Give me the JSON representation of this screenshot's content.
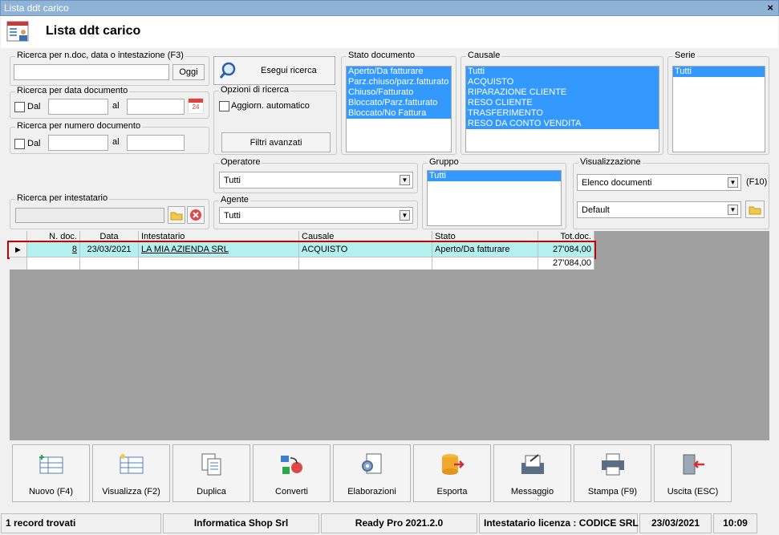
{
  "window": {
    "title": "Lista ddt carico",
    "close_glyph": "×"
  },
  "header": {
    "title": "Lista ddt carico",
    "icon": "document-list-icon"
  },
  "search_ndoc": {
    "label": "Ricerca per n.doc, data o intestazione (F3)",
    "value": "",
    "button": "Oggi"
  },
  "search_button": {
    "label": "Esegui ricerca",
    "icon": "search-icon"
  },
  "search_date": {
    "label": "Ricerca per data documento",
    "from_label": "Dal",
    "to_label": "al",
    "calendar_text": "24"
  },
  "search_number": {
    "label": "Ricerca per numero documento",
    "from_label": "Dal",
    "to_label": "al"
  },
  "options": {
    "label": "Opzioni di ricerca",
    "auto_update": "Aggiorn. automatico",
    "advanced_button": "Filtri avanzati"
  },
  "stato": {
    "label": "Stato documento",
    "items": [
      "Aperto/Da fatturare",
      "Parz.chiuso/parz.fatturato",
      "Chiuso/Fatturato",
      "Bloccato/Parz.fatturato",
      "Bloccato/No Fattura"
    ]
  },
  "causale": {
    "label": "Causale",
    "items": [
      "Tutti",
      "ACQUISTO",
      "RIPARAZIONE CLIENTE",
      "RESO CLIENTE",
      "TRASFERIMENTO",
      "RESO DA CONTO VENDITA"
    ]
  },
  "serie": {
    "label": "Serie",
    "items": [
      "Tutti"
    ]
  },
  "operatore": {
    "label": "Operatore",
    "value": "Tutti"
  },
  "agente": {
    "label": "Agente",
    "value": "Tutti"
  },
  "gruppo": {
    "label": "Gruppo",
    "items": [
      "Tutti"
    ]
  },
  "visualizzazione": {
    "label": "Visualizzazione",
    "value": "Elenco documenti",
    "shortcut": "(F10)",
    "layout": "Default"
  },
  "intestatario": {
    "label": "Ricerca per intestatario",
    "value": ""
  },
  "grid": {
    "columns": [
      "N. doc.",
      "Data",
      "Intestatario",
      "Causale",
      "Stato",
      "Tot.doc."
    ],
    "rows": [
      {
        "ndoc": "8",
        "data": "23/03/2021",
        "intestatario": "LA MIA AZIENDA SRL",
        "causale": "ACQUISTO",
        "stato": "Aperto/Da fatturare",
        "totale": "27'084,00"
      }
    ],
    "total": "27'084,00",
    "selected_color": "#b4f0f0",
    "highlight_color": "#cc0000"
  },
  "toolbar": [
    {
      "label": "Nuovo (F4)",
      "icon": "new-grid-icon"
    },
    {
      "label": "Visualizza (F2)",
      "icon": "view-grid-icon"
    },
    {
      "label": "Duplica",
      "icon": "duplicate-icon"
    },
    {
      "label": "Converti",
      "icon": "convert-icon"
    },
    {
      "label": "Elaborazioni",
      "icon": "gear-document-icon"
    },
    {
      "label": "Esporta",
      "icon": "export-database-icon"
    },
    {
      "label": "Messaggio",
      "icon": "message-icon"
    },
    {
      "label": "Stampa (F9)",
      "icon": "printer-icon"
    },
    {
      "label": "Uscita (ESC)",
      "icon": "exit-door-icon"
    }
  ],
  "status": {
    "records": "1 record trovati",
    "company": "Informatica Shop Srl",
    "version": "Ready Pro 2021.2.0",
    "license": "Intestatario licenza : CODICE SRL",
    "date": "23/03/2021",
    "time": "10:09"
  }
}
